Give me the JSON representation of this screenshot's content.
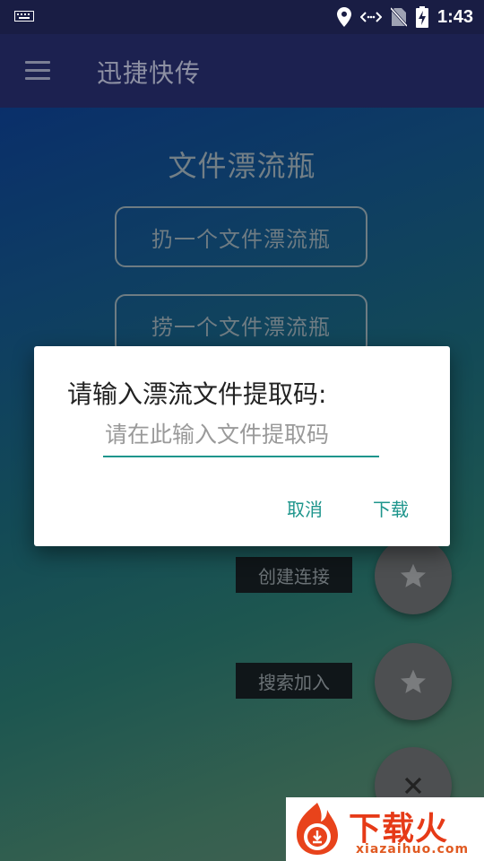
{
  "status_bar": {
    "time": "1:43"
  },
  "app_bar": {
    "title": "迅捷快传"
  },
  "main": {
    "section_title": "文件漂流瓶",
    "throw_button": "扔一个文件漂流瓶",
    "fish_button": "捞一个文件漂流瓶"
  },
  "fabs": {
    "create_label": "创建连接",
    "search_label": "搜索加入"
  },
  "dialog": {
    "title": "请输入漂流文件提取码:",
    "input_value": "",
    "input_placeholder": "请在此输入文件提取码",
    "cancel": "取消",
    "download": "下载"
  },
  "watermark": {
    "brand": "下载火",
    "url": "xiazaihuo.com"
  },
  "colors": {
    "accent": "#1e958c",
    "app_bar": "#1c2150",
    "status_bar": "#191d44",
    "fab": "#4d4f51"
  },
  "icons": [
    "keyboard-icon",
    "location-icon",
    "data-sync-icon",
    "no-sim-icon",
    "battery-charging-icon",
    "menu-icon",
    "star-icon",
    "close-icon"
  ]
}
